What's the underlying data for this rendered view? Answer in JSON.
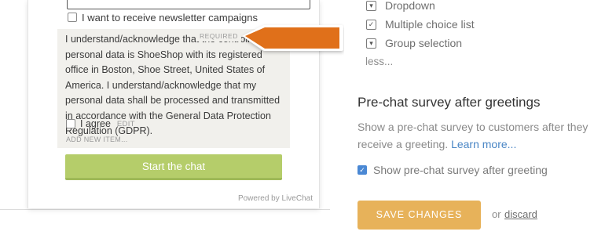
{
  "preview": {
    "newsletter_label": "I want to receive newsletter campaigns",
    "consent_text": "I understand/acknowledge that the controller of my personal data is ShoeShop with its registered office in Boston, Shoe Street, United States of America. I understand/acknowledge that my personal data shall be processed and transmitted in accordance with the General Data Protection Regulation (GDPR).",
    "required_badge": "REQUIRED",
    "agree_label": "I agree",
    "edit_label": "EDIT",
    "add_item_label": "ADD NEW ITEM...",
    "start_button": "Start the chat",
    "powered_by": "Powered by LiveChat"
  },
  "fields": {
    "options": [
      {
        "label": "Dropdown",
        "icon": "dropdown-icon"
      },
      {
        "label": "Multiple choice list",
        "icon": "checkbox-icon"
      },
      {
        "label": "Group selection",
        "icon": "dropdown-icon"
      }
    ],
    "less_link": "less..."
  },
  "settings": {
    "title": "Pre-chat survey after greetings",
    "description": "Show a pre-chat survey to customers after they receive a greeting.",
    "learn_more": "Learn more...",
    "show_checkbox_label": "Show pre-chat survey after greeting",
    "show_checkbox_checked": true,
    "save_button": "SAVE CHANGES",
    "or_text": "or",
    "discard_link": "discard"
  },
  "colors": {
    "accent_orange": "#e0701a",
    "start_green": "#b5cd6a",
    "save_yellow": "#e7b25a",
    "link_blue": "#4a86c5"
  }
}
